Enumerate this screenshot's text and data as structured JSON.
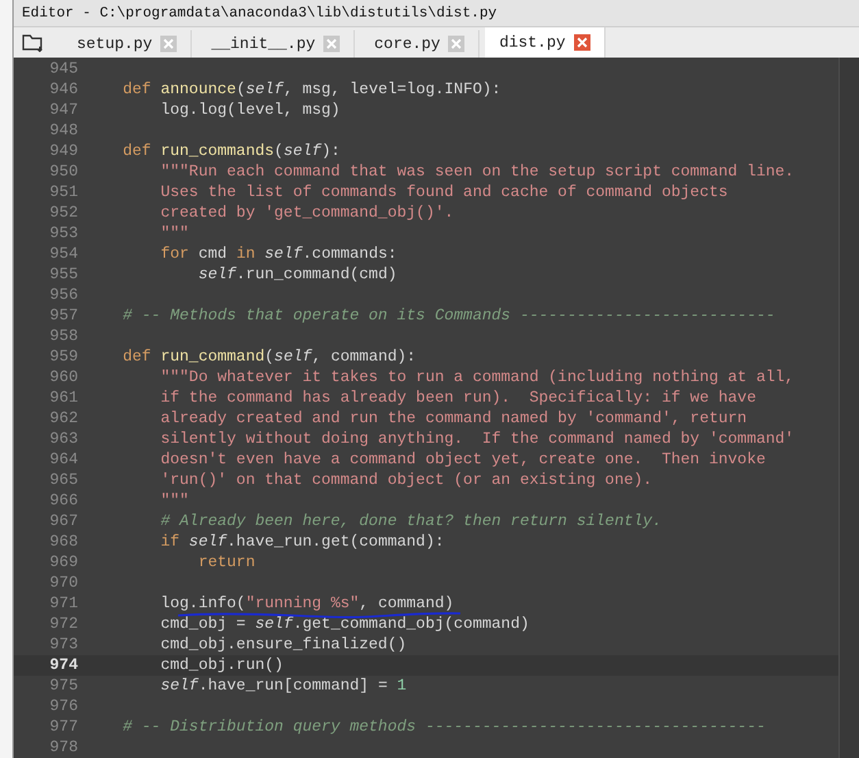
{
  "window": {
    "title": "Editor - C:\\programdata\\anaconda3\\lib\\distutils\\dist.py"
  },
  "tabs": [
    {
      "label": "setup.py",
      "selected": false
    },
    {
      "label": "__init__.py",
      "selected": false
    },
    {
      "label": "core.py",
      "selected": false
    },
    {
      "label": "dist.py",
      "selected": true
    }
  ],
  "editor": {
    "lines": [
      {
        "number": "945",
        "current": false
      },
      {
        "number": "946",
        "current": false,
        "tokens": [
          {
            "kind": "keyword",
            "text": "    def "
          },
          {
            "kind": "function",
            "text": "announce"
          },
          {
            "kind": "plain",
            "text": "("
          },
          {
            "kind": "self",
            "text": "self"
          },
          {
            "kind": "plain",
            "text": ", msg, level=log.INFO):"
          }
        ]
      },
      {
        "number": "947",
        "current": false,
        "tokens": [
          {
            "kind": "plain",
            "text": "        log.log(level, msg)"
          }
        ]
      },
      {
        "number": "948",
        "current": false
      },
      {
        "number": "949",
        "current": false,
        "tokens": [
          {
            "kind": "keyword",
            "text": "    def "
          },
          {
            "kind": "function",
            "text": "run_commands"
          },
          {
            "kind": "plain",
            "text": "("
          },
          {
            "kind": "self",
            "text": "self"
          },
          {
            "kind": "plain",
            "text": "):"
          }
        ]
      },
      {
        "number": "950",
        "current": false,
        "tokens": [
          {
            "kind": "string",
            "text": "        \"\"\"Run each command that was seen on the setup script command line."
          }
        ]
      },
      {
        "number": "951",
        "current": false,
        "tokens": [
          {
            "kind": "string",
            "text": "        Uses the list of commands found and cache of command objects"
          }
        ]
      },
      {
        "number": "952",
        "current": false,
        "tokens": [
          {
            "kind": "string",
            "text": "        created by 'get_command_obj()'."
          }
        ]
      },
      {
        "number": "953",
        "current": false,
        "tokens": [
          {
            "kind": "string",
            "text": "        \"\"\""
          }
        ]
      },
      {
        "number": "954",
        "current": false,
        "tokens": [
          {
            "kind": "keyword",
            "text": "        for"
          },
          {
            "kind": "plain",
            "text": " cmd "
          },
          {
            "kind": "keyword",
            "text": "in "
          },
          {
            "kind": "self",
            "text": "self"
          },
          {
            "kind": "plain",
            "text": ".commands:"
          }
        ]
      },
      {
        "number": "955",
        "current": false,
        "tokens": [
          {
            "kind": "self",
            "text": "            self"
          },
          {
            "kind": "plain",
            "text": ".run_command(cmd)"
          }
        ]
      },
      {
        "number": "956",
        "current": false
      },
      {
        "number": "957",
        "current": false,
        "tokens": [
          {
            "kind": "comment",
            "text": "    # -- Methods that operate on its Commands ---------------------------"
          }
        ]
      },
      {
        "number": "958",
        "current": false
      },
      {
        "number": "959",
        "current": false,
        "tokens": [
          {
            "kind": "keyword",
            "text": "    def "
          },
          {
            "kind": "function",
            "text": "run_command"
          },
          {
            "kind": "plain",
            "text": "("
          },
          {
            "kind": "self",
            "text": "self"
          },
          {
            "kind": "plain",
            "text": ", command):"
          }
        ]
      },
      {
        "number": "960",
        "current": false,
        "tokens": [
          {
            "kind": "string",
            "text": "        \"\"\"Do whatever it takes to run a command (including nothing at all,"
          }
        ]
      },
      {
        "number": "961",
        "current": false,
        "tokens": [
          {
            "kind": "string",
            "text": "        if the command has already been run).  Specifically: if we have"
          }
        ]
      },
      {
        "number": "962",
        "current": false,
        "tokens": [
          {
            "kind": "string",
            "text": "        already created and run the command named by 'command', return"
          }
        ]
      },
      {
        "number": "963",
        "current": false,
        "tokens": [
          {
            "kind": "string",
            "text": "        silently without doing anything.  If the command named by 'command'"
          }
        ]
      },
      {
        "number": "964",
        "current": false,
        "tokens": [
          {
            "kind": "string",
            "text": "        doesn't even have a command object yet, create one.  Then invoke"
          }
        ]
      },
      {
        "number": "965",
        "current": false,
        "tokens": [
          {
            "kind": "string",
            "text": "        'run()' on that command object (or an existing one)."
          }
        ]
      },
      {
        "number": "966",
        "current": false,
        "tokens": [
          {
            "kind": "string",
            "text": "        \"\"\""
          }
        ]
      },
      {
        "number": "967",
        "current": false,
        "tokens": [
          {
            "kind": "comment",
            "text": "        # Already been here, done that? then return silently."
          }
        ]
      },
      {
        "number": "968",
        "current": false,
        "tokens": [
          {
            "kind": "keyword",
            "text": "        if "
          },
          {
            "kind": "self",
            "text": "self"
          },
          {
            "kind": "plain",
            "text": ".have_run.get(command):"
          }
        ]
      },
      {
        "number": "969",
        "current": false,
        "tokens": [
          {
            "kind": "keyword",
            "text": "            return"
          }
        ]
      },
      {
        "number": "970",
        "current": false
      },
      {
        "number": "971",
        "current": false,
        "tokens": [
          {
            "kind": "plain",
            "text": "        log.info("
          },
          {
            "kind": "string",
            "text": "\"running %s\""
          },
          {
            "kind": "plain",
            "text": ", command)"
          }
        ]
      },
      {
        "number": "972",
        "current": false,
        "tokens": [
          {
            "kind": "plain",
            "text": "        cmd_obj = "
          },
          {
            "kind": "self",
            "text": "self"
          },
          {
            "kind": "plain",
            "text": ".get_command_obj(command)"
          }
        ]
      },
      {
        "number": "973",
        "current": false,
        "tokens": [
          {
            "kind": "plain",
            "text": "        cmd_obj.ensure_finalized()"
          }
        ]
      },
      {
        "number": "974",
        "current": true,
        "tokens": [
          {
            "kind": "plain",
            "text": "        cmd_obj.run()"
          }
        ]
      },
      {
        "number": "975",
        "current": false,
        "tokens": [
          {
            "kind": "self",
            "text": "        self"
          },
          {
            "kind": "plain",
            "text": ".have_run[command] = "
          },
          {
            "kind": "number",
            "text": "1"
          }
        ]
      },
      {
        "number": "976",
        "current": false
      },
      {
        "number": "977",
        "current": false,
        "tokens": [
          {
            "kind": "comment",
            "text": "    # -- Distribution query methods ------------------------------------"
          }
        ]
      },
      {
        "number": "978",
        "current": false
      }
    ]
  }
}
